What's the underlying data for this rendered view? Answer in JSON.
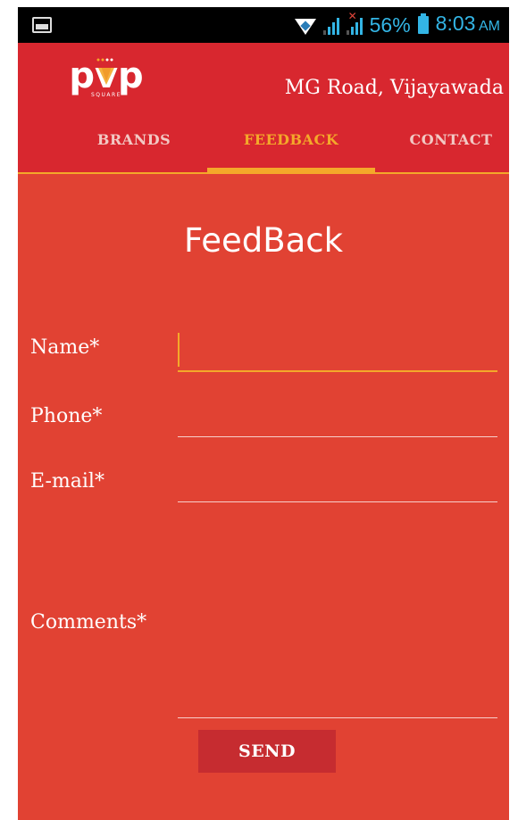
{
  "status_bar": {
    "battery_percent": "56%",
    "time": "8:03",
    "time_suffix": "AM",
    "icons": [
      "gallery-icon",
      "wifi-icon",
      "signal-icon",
      "signal-icon-no-sim",
      "battery-icon"
    ]
  },
  "header": {
    "logo_text": "pvp",
    "logo_subtext": "SQUARE",
    "location": "MG Road, Vijayawada",
    "tabs": [
      {
        "label": "BRANDS",
        "active": false
      },
      {
        "label": "FEEDBACK",
        "active": true
      },
      {
        "label": "CONTACT",
        "active": false
      }
    ]
  },
  "form": {
    "title": "FeedBack",
    "fields": {
      "name": {
        "label": "Name*",
        "value": ""
      },
      "phone": {
        "label": "Phone*",
        "value": ""
      },
      "email": {
        "label": "E-mail*",
        "value": ""
      },
      "comments": {
        "label": "Comments*",
        "value": ""
      }
    },
    "send_label": "SEND"
  },
  "colors": {
    "background": "#e14233",
    "header": "#d8272f",
    "accent": "#f4a82a",
    "button": "#c62c30",
    "status_text": "#33b5e5"
  }
}
